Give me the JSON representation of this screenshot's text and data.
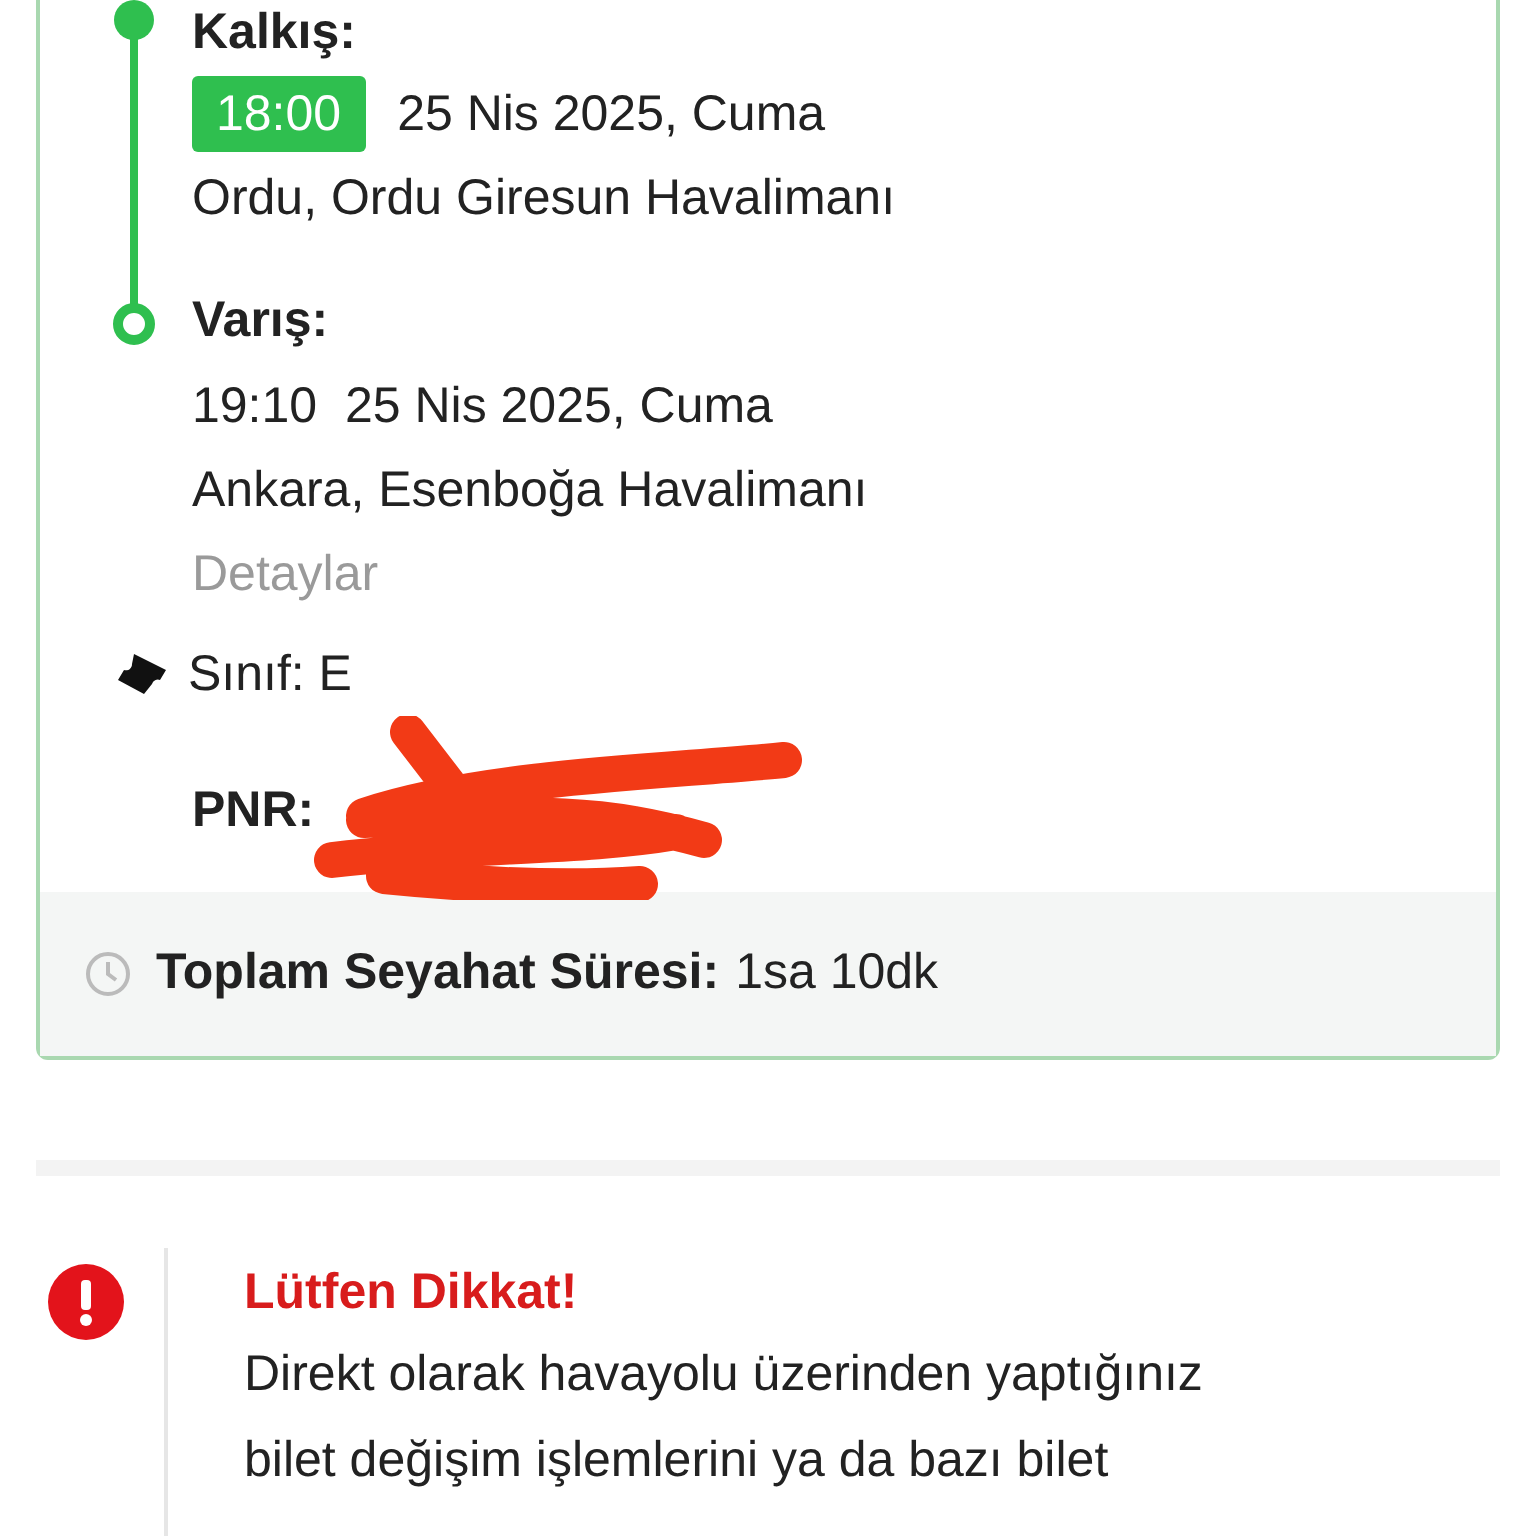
{
  "departure": {
    "label": "Kalkış:",
    "time": "18:00",
    "date": "25 Nis 2025, Cuma",
    "place": "Ordu, Ordu Giresun Havalimanı"
  },
  "arrival": {
    "label": "Varış:",
    "time": "19:10",
    "date": "25 Nis 2025, Cuma",
    "place": "Ankara, Esenboğa Havalimanı"
  },
  "details_link": "Detaylar",
  "class_info": "Sınıf: E",
  "pnr": {
    "label": "PNR:"
  },
  "total_duration": {
    "label": "Toplam Seyahat Süresi:",
    "value": "1sa 10dk"
  },
  "notice": {
    "title": "Lütfen Dikkat!",
    "text": "Direkt olarak havayolu üzerinden yaptığınız bilet değişim işlemlerini ya da bazı bilet"
  }
}
